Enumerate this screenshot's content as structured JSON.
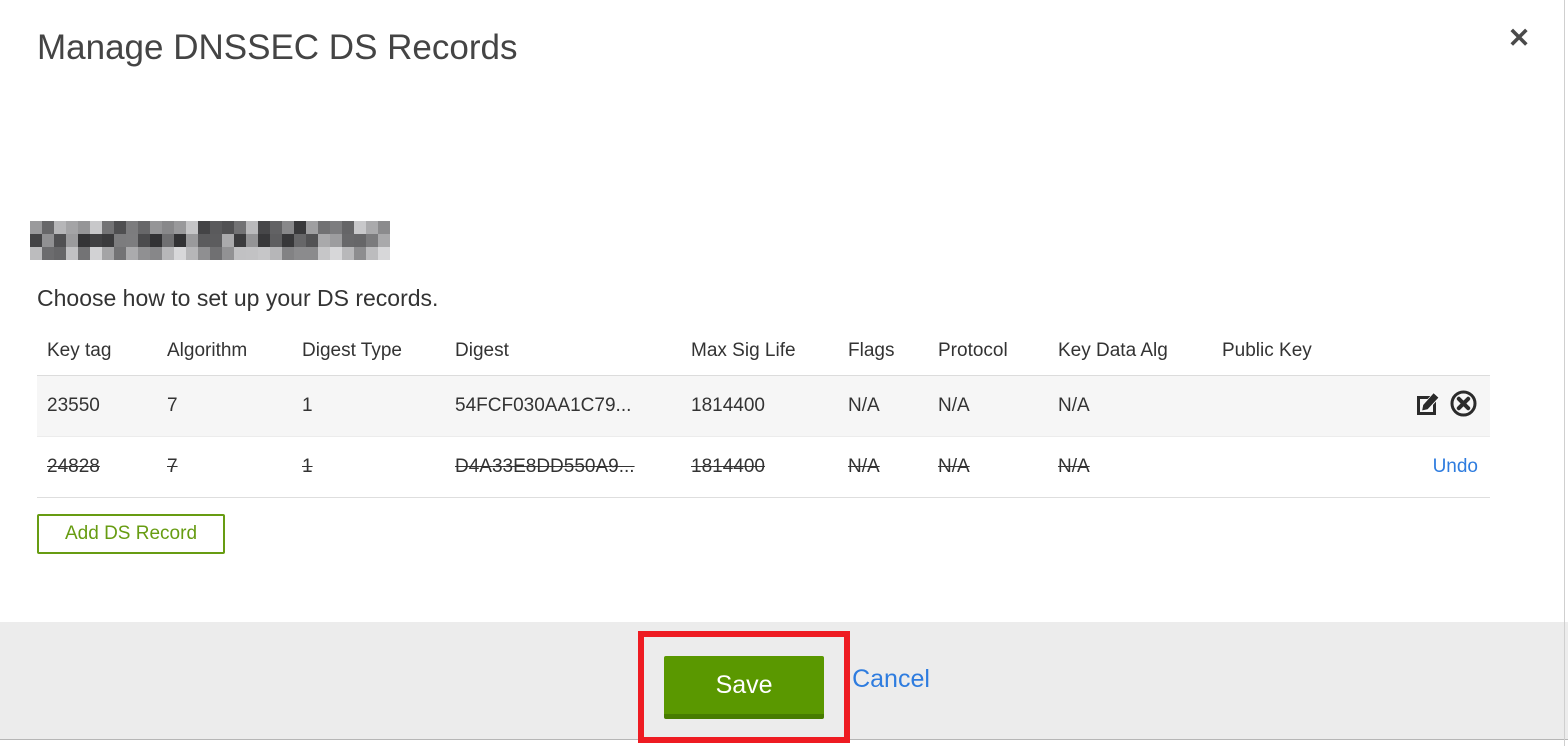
{
  "modal": {
    "title": "Manage DNSSEC DS Records",
    "close_glyph": "✕",
    "domain": {
      "redacted": true
    },
    "subtitle": "Choose how to set up your DS records.",
    "table": {
      "columns": [
        "Key tag",
        "Algorithm",
        "Digest Type",
        "Digest",
        "Max Sig Life",
        "Flags",
        "Protocol",
        "Key Data Alg",
        "Public Key"
      ],
      "rows": [
        {
          "cells": [
            "23550",
            "7",
            "1",
            "54FCF030AA1C79...",
            "1814400",
            "N/A",
            "N/A",
            "N/A",
            ""
          ],
          "deleted": false,
          "actions": [
            "edit",
            "delete"
          ]
        },
        {
          "cells": [
            "24828",
            "7",
            "1",
            "D4A33E8DD550A9...",
            "1814400",
            "N/A",
            "N/A",
            "N/A",
            ""
          ],
          "deleted": true,
          "undo_label": "Undo"
        }
      ]
    },
    "add_button_label": "Add DS Record",
    "footer": {
      "save_label": "Save",
      "cancel_label": "Cancel"
    }
  },
  "colors": {
    "accent_green_button": "#5a9800",
    "accent_green_outline": "#679c12",
    "link_blue": "#2e7cdf",
    "annotation_red": "#ee1b22",
    "footer_gray": "#ececec",
    "row_stripe_gray": "#f6f6f6",
    "text_dark": "#333333"
  }
}
